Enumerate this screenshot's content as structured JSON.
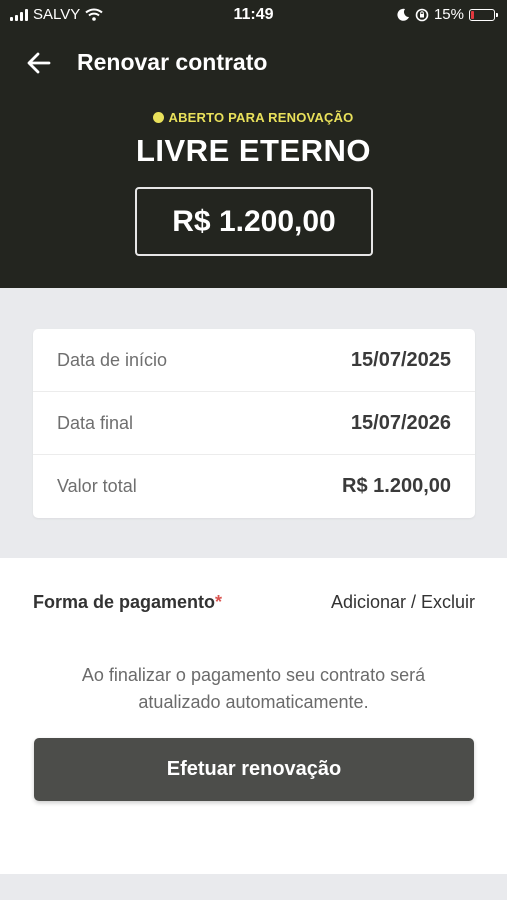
{
  "status_bar": {
    "carrier": "SALVY",
    "time": "11:49",
    "battery": "15%",
    "battery_level": 0.15
  },
  "header": {
    "title": "Renovar contrato",
    "status": "ABERTO PARA RENOVAÇÃO",
    "plan_name": "LIVRE ETERNO",
    "price": "R$ 1.200,00"
  },
  "details": [
    {
      "label": "Data de início",
      "value": "15/07/2025"
    },
    {
      "label": "Data final",
      "value": "15/07/2026"
    },
    {
      "label": "Valor total",
      "value": "R$ 1.200,00"
    }
  ],
  "payment": {
    "label": "Forma de pagamento",
    "required_mark": "*",
    "action": "Adicionar / Excluir",
    "info": "Ao finalizar o pagamento seu contrato será atualizado automaticamente.",
    "button": "Efetuar renovação"
  },
  "colors": {
    "header_bg": "#23251f",
    "accent": "#e9e15b",
    "button_bg": "#4c4d4a",
    "battery_low": "#e0383e"
  }
}
